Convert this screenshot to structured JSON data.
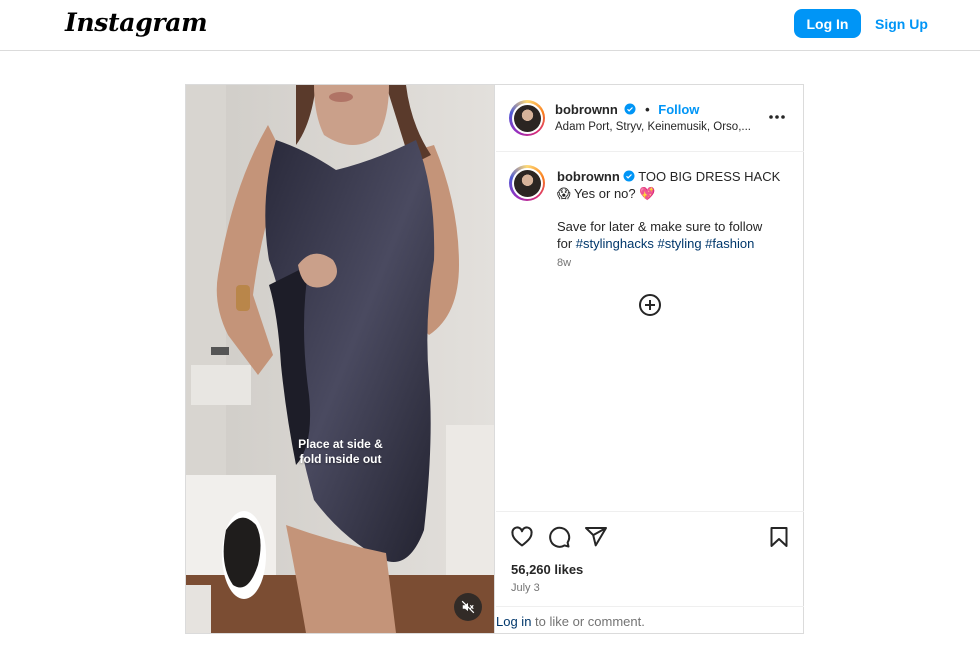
{
  "header": {
    "logo_text": "Instagram",
    "login_label": "Log In",
    "signup_label": "Sign Up"
  },
  "post": {
    "username": "bobrownn",
    "follow_label": "Follow",
    "audio": "Adam Port, Stryv, Keinemusik, Orso,...",
    "video_overlay_line1": "Place at side &",
    "video_overlay_line2": "fold inside out",
    "caption": {
      "title": "TOO BIG DRESS HACK",
      "line2": "Yes or no?",
      "line3": "Save for later & make sure to follow",
      "line4_prefix": "for",
      "hashtags": [
        "#stylinghacks",
        "#styling",
        "#fashion"
      ],
      "time": "8w"
    },
    "likes": "56,260 likes",
    "date": "July 3",
    "login_prompt_link": "Log in",
    "login_prompt_rest": "to like or comment."
  },
  "colors": {
    "brand_blue": "#0095f6",
    "link_dark": "#00376b",
    "border": "#dbdbdb",
    "muted_text": "#737373"
  },
  "icons": [
    "more-icon",
    "verified-icon",
    "load-more-icon",
    "heart-icon",
    "comment-icon",
    "share-icon",
    "bookmark-icon",
    "mute-icon"
  ]
}
